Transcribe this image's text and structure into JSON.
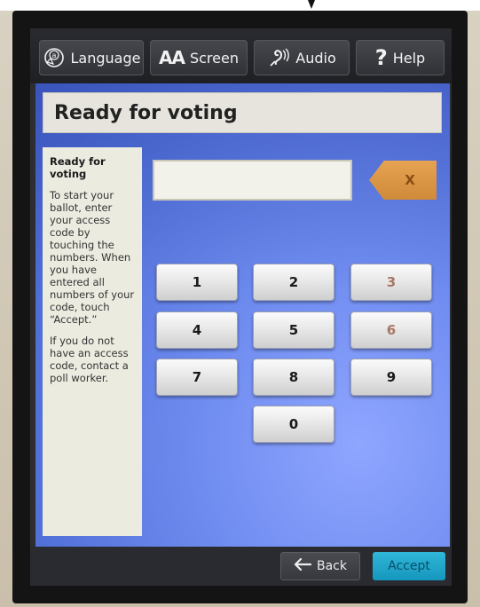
{
  "toolbar": {
    "language_label": "Language",
    "screen_label": "Screen",
    "screen_icon_text": "AA",
    "audio_label": "Audio",
    "help_label": "Help",
    "help_icon_text": "?"
  },
  "page": {
    "title": "Ready for voting"
  },
  "instructions": {
    "heading": "Ready for voting",
    "paragraph1": "To start your ballot, enter your access code by touching the numbers.  When you have entered all numbers of your code, touch “Accept.”",
    "paragraph2": "If you do not have an access code, contact a poll worker."
  },
  "access_code": {
    "value": "",
    "clear_label": "X"
  },
  "keypad": {
    "keys": [
      "1",
      "2",
      "3",
      "4",
      "5",
      "6",
      "7",
      "8",
      "9",
      "0"
    ]
  },
  "footer": {
    "back_label": "Back",
    "accept_label": "Accept"
  },
  "colors": {
    "screen_blue": "#6f8cf0",
    "clear_orange": "#e6a352",
    "accept_cyan": "#1fa7cc",
    "panel_beige": "#ecebe0"
  }
}
